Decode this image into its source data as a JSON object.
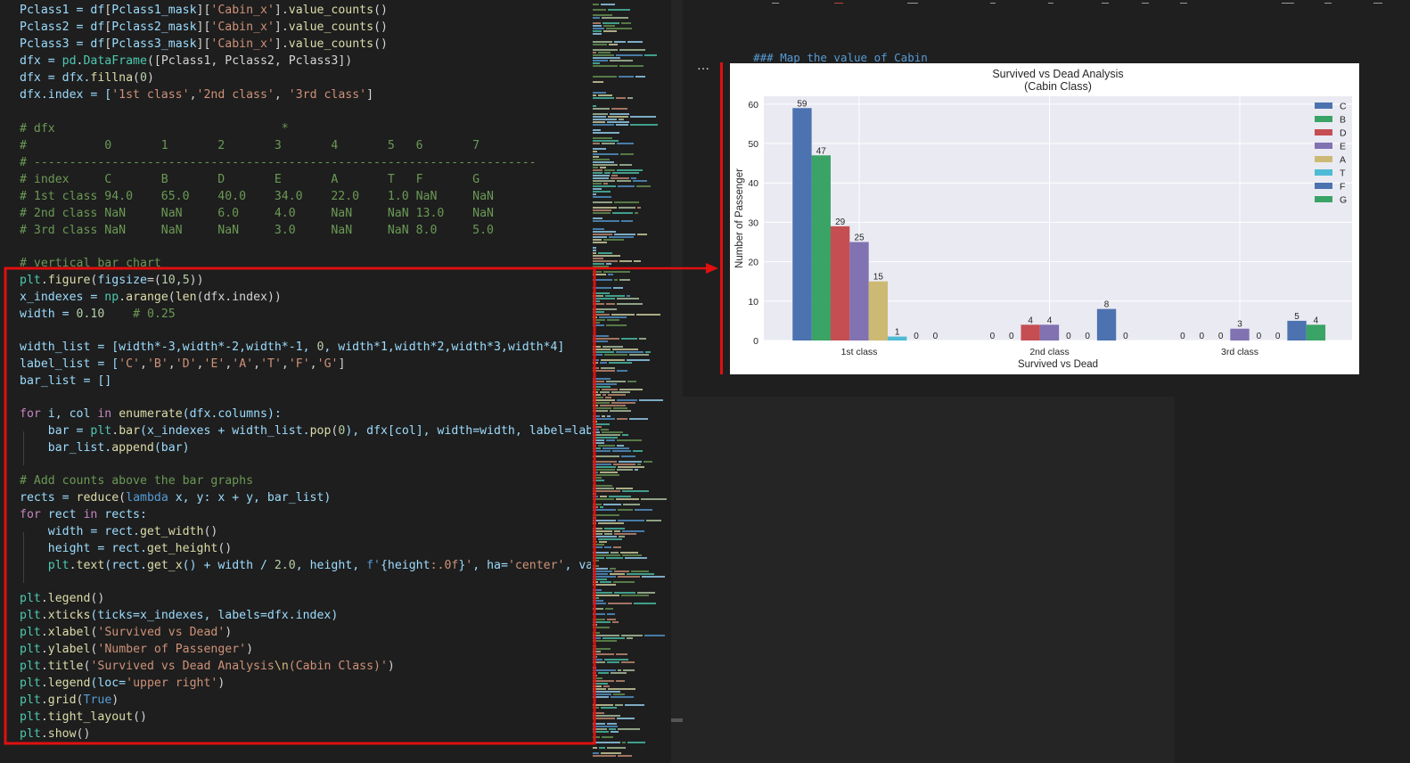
{
  "editor": {
    "lines": [
      {
        "y": 12,
        "tokens": [
          [
            "Pclass1 = ",
            "#9cdcfe"
          ],
          [
            "df",
            "#9cdcfe"
          ],
          [
            "[",
            "#d4d4d4"
          ],
          [
            "Pclass1_mask",
            "#9cdcfe"
          ],
          [
            "][",
            "#d4d4d4"
          ],
          [
            "'Cabin_x'",
            "#ce9178"
          ],
          [
            "].",
            "#d4d4d4"
          ],
          [
            "value_counts",
            "#dcdcaa"
          ],
          [
            "()",
            "#d4d4d4"
          ]
        ]
      },
      {
        "y": 31,
        "tokens": [
          [
            "Pclass2 = ",
            "#9cdcfe"
          ],
          [
            "df",
            "#9cdcfe"
          ],
          [
            "[",
            "#d4d4d4"
          ],
          [
            "Pclass2_mask",
            "#9cdcfe"
          ],
          [
            "][",
            "#d4d4d4"
          ],
          [
            "'Cabin_x'",
            "#ce9178"
          ],
          [
            "].",
            "#d4d4d4"
          ],
          [
            "value_counts",
            "#dcdcaa"
          ],
          [
            "()",
            "#d4d4d4"
          ]
        ]
      },
      {
        "y": 50,
        "tokens": [
          [
            "Pclass3 = ",
            "#9cdcfe"
          ],
          [
            "df",
            "#9cdcfe"
          ],
          [
            "[",
            "#d4d4d4"
          ],
          [
            "Pclass3_mask",
            "#9cdcfe"
          ],
          [
            "][",
            "#d4d4d4"
          ],
          [
            "'Cabin_x'",
            "#ce9178"
          ],
          [
            "].",
            "#d4d4d4"
          ],
          [
            "value_counts",
            "#dcdcaa"
          ],
          [
            "()",
            "#d4d4d4"
          ]
        ]
      },
      {
        "y": 69,
        "tokens": [
          [
            "dfx = ",
            "#9cdcfe"
          ],
          [
            "pd",
            "#4ec9b0"
          ],
          [
            ".",
            "#d4d4d4"
          ],
          [
            "DataFrame",
            "#4ec9b0"
          ],
          [
            "([Pclass1, Pclass2, Pclass3])",
            "#d4d4d4"
          ]
        ]
      },
      {
        "y": 88,
        "tokens": [
          [
            "dfx = ",
            "#9cdcfe"
          ],
          [
            "dfx.",
            "#9cdcfe"
          ],
          [
            "fillna",
            "#dcdcaa"
          ],
          [
            "(",
            "#d4d4d4"
          ],
          [
            "0",
            "#b5cea8"
          ],
          [
            ")",
            "#d4d4d4"
          ]
        ]
      },
      {
        "y": 107,
        "tokens": [
          [
            "dfx.index = [",
            "#9cdcfe"
          ],
          [
            "'1st class'",
            "#ce9178"
          ],
          [
            ",",
            "#d4d4d4"
          ],
          [
            "'2nd class'",
            "#ce9178"
          ],
          [
            ", ",
            "#d4d4d4"
          ],
          [
            "'3rd class'",
            "#ce9178"
          ],
          [
            "]",
            "#d4d4d4"
          ]
        ]
      },
      {
        "y": 145,
        "tokens": [
          [
            "# dfx                                *",
            "#6a9955"
          ]
        ]
      },
      {
        "y": 164,
        "tokens": [
          [
            "#           0       1       2       3       4       5   6       7",
            "#6a9955"
          ]
        ]
      },
      {
        "y": 183,
        "tokens": [
          [
            "# -----------------------------------------------------------------------",
            "#6a9955"
          ]
        ]
      },
      {
        "y": 202,
        "tokens": [
          [
            "# index     C       B       D       E       A       T   F       G",
            "#6a9955"
          ]
        ]
      },
      {
        "y": 221,
        "tokens": [
          [
            "# 1st class 94.0    65.0    40.0    34.0    22.0    1.0 NaN     NaN",
            "#6a9955"
          ]
        ]
      },
      {
        "y": 240,
        "tokens": [
          [
            "# 2nd class NaN     NaN     6.0     4.0     NaN     NaN 13.0    NaN",
            "#6a9955"
          ]
        ]
      },
      {
        "y": 259,
        "tokens": [
          [
            "# 3rd class NaN     NaN     NaN     3.0     NaN     NaN 8.0     5.0",
            "#6a9955"
          ]
        ]
      },
      {
        "y": 296,
        "tokens": [
          [
            "# vertical bar chart",
            "#6a9955"
          ]
        ]
      },
      {
        "y": 315,
        "tokens": [
          [
            "plt",
            "#4ec9b0"
          ],
          [
            ".",
            "#d4d4d4"
          ],
          [
            "figure",
            "#dcdcaa"
          ],
          [
            "(",
            "#d4d4d4"
          ],
          [
            "figsize",
            "#9cdcfe"
          ],
          [
            "=(",
            "#d4d4d4"
          ],
          [
            "10",
            "#b5cea8"
          ],
          [
            ",",
            "#d4d4d4"
          ],
          [
            "5",
            "#b5cea8"
          ],
          [
            "))",
            "#d4d4d4"
          ]
        ]
      },
      {
        "y": 334,
        "tokens": [
          [
            "x_indexes = ",
            "#9cdcfe"
          ],
          [
            "np",
            "#4ec9b0"
          ],
          [
            ".",
            "#d4d4d4"
          ],
          [
            "arange",
            "#dcdcaa"
          ],
          [
            "(",
            "#d4d4d4"
          ],
          [
            "len",
            "#dcdcaa"
          ],
          [
            "(dfx.index))",
            "#d4d4d4"
          ]
        ]
      },
      {
        "y": 353,
        "tokens": [
          [
            "width = ",
            "#9cdcfe"
          ],
          [
            "0.10",
            "#b5cea8"
          ],
          [
            "    ",
            "#d4d4d4"
          ],
          [
            "# 0.25",
            "#6a9955"
          ]
        ]
      },
      {
        "y": 390,
        "tokens": [
          [
            "width_list = [width*-3,width*-2,width*-1, ",
            "#9cdcfe"
          ],
          [
            "0",
            "#b5cea8"
          ],
          [
            ", width*1,width*2,width*3,width*4]",
            "#9cdcfe"
          ]
        ]
      },
      {
        "y": 409,
        "tokens": [
          [
            "label_list = [",
            "#9cdcfe"
          ],
          [
            "'C'",
            "#ce9178"
          ],
          [
            ",",
            "#d4d4d4"
          ],
          [
            "'B'",
            "#ce9178"
          ],
          [
            ",",
            "#d4d4d4"
          ],
          [
            "'D'",
            "#ce9178"
          ],
          [
            ",",
            "#d4d4d4"
          ],
          [
            "'E'",
            "#ce9178"
          ],
          [
            ",",
            "#d4d4d4"
          ],
          [
            "'A'",
            "#ce9178"
          ],
          [
            ",",
            "#d4d4d4"
          ],
          [
            "'T'",
            "#ce9178"
          ],
          [
            ",",
            "#d4d4d4"
          ],
          [
            "'F'",
            "#ce9178"
          ],
          [
            ",",
            "#d4d4d4"
          ],
          [
            "'G'",
            "#ce9178"
          ],
          [
            "]",
            "#d4d4d4"
          ]
        ]
      },
      {
        "y": 428,
        "tokens": [
          [
            "bar_list = []",
            "#9cdcfe"
          ]
        ]
      },
      {
        "y": 465,
        "tokens": [
          [
            "for",
            "#c586c0"
          ],
          [
            " i, col ",
            "#9cdcfe"
          ],
          [
            "in",
            "#c586c0"
          ],
          [
            " ",
            "#d4d4d4"
          ],
          [
            "enumerate",
            "#dcdcaa"
          ],
          [
            "(dfx.columns):",
            "#9cdcfe"
          ]
        ]
      },
      {
        "y": 484,
        "tokens": [
          [
            "    bar = ",
            "#9cdcfe"
          ],
          [
            "plt",
            "#4ec9b0"
          ],
          [
            ".",
            "#d4d4d4"
          ],
          [
            "bar",
            "#dcdcaa"
          ],
          [
            "(x_indexes + width_list.",
            "#9cdcfe"
          ],
          [
            "pop",
            "#dcdcaa"
          ],
          [
            "(",
            "#d4d4d4"
          ],
          [
            "0",
            "#b5cea8"
          ],
          [
            "), dfx[col], width=width, label=label_",
            "#9cdcfe"
          ]
        ]
      },
      {
        "y": 503,
        "tokens": [
          [
            "    bar_list.",
            "#9cdcfe"
          ],
          [
            "append",
            "#dcdcaa"
          ],
          [
            "(bar)",
            "#9cdcfe"
          ]
        ]
      },
      {
        "y": 540,
        "tokens": [
          [
            "# Add counts above the bar graphs",
            "#6a9955"
          ]
        ]
      },
      {
        "y": 559,
        "tokens": [
          [
            "rects = ",
            "#9cdcfe"
          ],
          [
            "reduce",
            "#dcdcaa"
          ],
          [
            "(",
            "#d4d4d4"
          ],
          [
            "lambda",
            "#569cd6"
          ],
          [
            " x, y: x + y, bar_list)",
            "#9cdcfe"
          ]
        ]
      },
      {
        "y": 578,
        "tokens": [
          [
            "for",
            "#c586c0"
          ],
          [
            " rect ",
            "#9cdcfe"
          ],
          [
            "in",
            "#c586c0"
          ],
          [
            " rects:",
            "#9cdcfe"
          ]
        ]
      },
      {
        "y": 597,
        "tokens": [
          [
            "    width = rect.",
            "#9cdcfe"
          ],
          [
            "get_width",
            "#dcdcaa"
          ],
          [
            "()",
            "#d4d4d4"
          ]
        ]
      },
      {
        "y": 616,
        "tokens": [
          [
            "    height = rect.",
            "#9cdcfe"
          ],
          [
            "get_height",
            "#dcdcaa"
          ],
          [
            "()",
            "#d4d4d4"
          ]
        ]
      },
      {
        "y": 635,
        "tokens": [
          [
            "    plt",
            "#4ec9b0"
          ],
          [
            ".",
            "#d4d4d4"
          ],
          [
            "text",
            "#dcdcaa"
          ],
          [
            "(rect.",
            "#9cdcfe"
          ],
          [
            "get_x",
            "#dcdcaa"
          ],
          [
            "() + width / ",
            "#9cdcfe"
          ],
          [
            "2.0",
            "#b5cea8"
          ],
          [
            ", height, ",
            "#9cdcfe"
          ],
          [
            "f'",
            "#569cd6"
          ],
          [
            "{height",
            "#9cdcfe"
          ],
          [
            ":.0f",
            "#ce9178"
          ],
          [
            "}",
            "#9cdcfe"
          ],
          [
            "'",
            "#ce9178"
          ],
          [
            ", ha=",
            "#9cdcfe"
          ],
          [
            "'center'",
            "#ce9178"
          ],
          [
            ", va=",
            "#9cdcfe"
          ],
          [
            "'|",
            "#ce9178"
          ]
        ]
      },
      {
        "y": 672,
        "tokens": [
          [
            "plt",
            "#4ec9b0"
          ],
          [
            ".",
            "#d4d4d4"
          ],
          [
            "legend",
            "#dcdcaa"
          ],
          [
            "()",
            "#d4d4d4"
          ]
        ]
      },
      {
        "y": 691,
        "tokens": [
          [
            "plt",
            "#4ec9b0"
          ],
          [
            ".",
            "#d4d4d4"
          ],
          [
            "xticks",
            "#dcdcaa"
          ],
          [
            "(ticks=x_indexes, labels=dfx.index)",
            "#9cdcfe"
          ]
        ]
      },
      {
        "y": 710,
        "tokens": [
          [
            "plt",
            "#4ec9b0"
          ],
          [
            ".",
            "#d4d4d4"
          ],
          [
            "xlabel",
            "#dcdcaa"
          ],
          [
            "(",
            "#d4d4d4"
          ],
          [
            "'Survived vs Dead'",
            "#ce9178"
          ],
          [
            ")",
            "#d4d4d4"
          ]
        ]
      },
      {
        "y": 729,
        "tokens": [
          [
            "plt",
            "#4ec9b0"
          ],
          [
            ".",
            "#d4d4d4"
          ],
          [
            "ylabel",
            "#dcdcaa"
          ],
          [
            "(",
            "#d4d4d4"
          ],
          [
            "'Number of Passenger'",
            "#ce9178"
          ],
          [
            ")",
            "#d4d4d4"
          ]
        ]
      },
      {
        "y": 748,
        "tokens": [
          [
            "plt",
            "#4ec9b0"
          ],
          [
            ".",
            "#d4d4d4"
          ],
          [
            "title",
            "#dcdcaa"
          ],
          [
            "(",
            "#d4d4d4"
          ],
          [
            "'Survived vs Dead Analysis",
            "#ce9178"
          ],
          [
            "\\n",
            "#d7ba7d"
          ],
          [
            "(Cabin Class)'",
            "#ce9178"
          ],
          [
            ")",
            "#d4d4d4"
          ]
        ]
      },
      {
        "y": 767,
        "tokens": [
          [
            "plt",
            "#4ec9b0"
          ],
          [
            ".",
            "#d4d4d4"
          ],
          [
            "legend",
            "#dcdcaa"
          ],
          [
            "(loc=",
            "#9cdcfe"
          ],
          [
            "'upper right'",
            "#ce9178"
          ],
          [
            ")",
            "#d4d4d4"
          ]
        ]
      },
      {
        "y": 786,
        "tokens": [
          [
            "plt",
            "#4ec9b0"
          ],
          [
            ".",
            "#d4d4d4"
          ],
          [
            "grid",
            "#dcdcaa"
          ],
          [
            "(",
            "#d4d4d4"
          ],
          [
            "True",
            "#569cd6"
          ],
          [
            ")",
            "#d4d4d4"
          ]
        ]
      },
      {
        "y": 805,
        "tokens": [
          [
            "plt",
            "#4ec9b0"
          ],
          [
            ".",
            "#d4d4d4"
          ],
          [
            "tight_layout",
            "#dcdcaa"
          ],
          [
            "()",
            "#d4d4d4"
          ]
        ]
      },
      {
        "y": 824,
        "tokens": [
          [
            "plt",
            "#4ec9b0"
          ],
          [
            ".",
            "#d4d4d4"
          ],
          [
            "show",
            "#dcdcaa"
          ],
          [
            "()",
            "#d4d4d4"
          ]
        ]
      }
    ]
  },
  "notebook": {
    "markdown_cell": "### Map the value of Cabin",
    "markdown_ellipsis": "…",
    "cell_menu": "…"
  },
  "chart_data": {
    "type": "bar",
    "title": "Survived vs Dead Analysis\n(Cabin Class)",
    "title_lines": [
      "Survived vs Dead Analysis",
      "(Cabin Class)"
    ],
    "xlabel": "Survived vs Dead",
    "ylabel": "Number of Passenger",
    "categories": [
      "1st class",
      "2nd class",
      "3rd class"
    ],
    "ylim": [
      0,
      62
    ],
    "yticks": [
      0,
      10,
      20,
      30,
      40,
      50,
      60
    ],
    "grid": true,
    "legend_position": "upper right",
    "series": [
      {
        "name": "C",
        "color": "#4c72b0",
        "values": [
          59,
          0,
          0
        ]
      },
      {
        "name": "B",
        "color": "#3aa366",
        "values": [
          47,
          0,
          0
        ]
      },
      {
        "name": "D",
        "color": "#c44e52",
        "values": [
          29,
          4,
          0
        ]
      },
      {
        "name": "E",
        "color": "#8172b2",
        "values": [
          25,
          4,
          3
        ]
      },
      {
        "name": "A",
        "color": "#ccb974",
        "values": [
          15,
          0,
          0
        ]
      },
      {
        "name": "T",
        "color": "#4dbbd5",
        "values": [
          1,
          0,
          0
        ]
      },
      {
        "name": "F",
        "color": "#4c72b0",
        "values": [
          0,
          8,
          5
        ]
      },
      {
        "name": "G",
        "color": "#3aa366",
        "values": [
          0,
          0,
          4
        ]
      }
    ],
    "data_labels": [
      [
        "59",
        "47",
        "29",
        "25",
        "15",
        "1",
        "0",
        "0"
      ],
      [
        "0",
        "0",
        "4",
        "4",
        "0",
        "0",
        "8",
        "0"
      ],
      [
        "0",
        "0",
        "0",
        "3",
        "0",
        "0",
        "5",
        "4"
      ]
    ]
  },
  "colors": {
    "editor_bg": "#1e1e1e",
    "annotation_red": "#e01010",
    "plot_bg": "#eaeaf2"
  }
}
